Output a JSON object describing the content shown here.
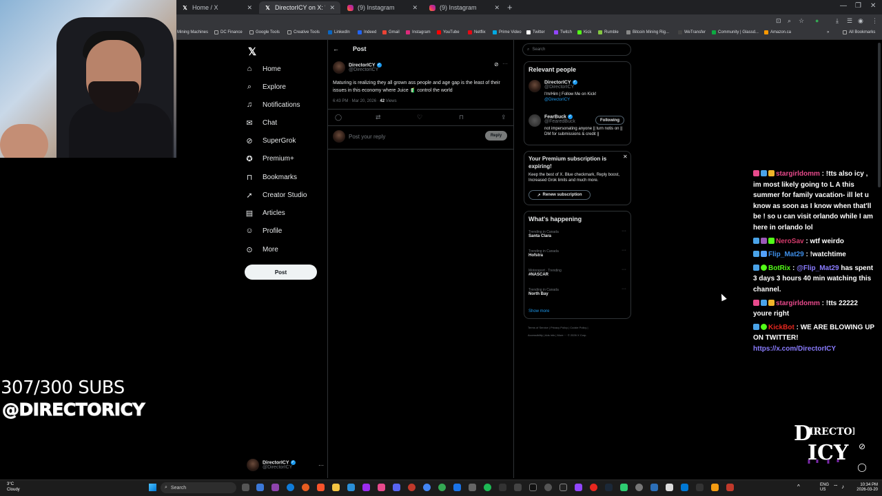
{
  "browser": {
    "tabs": [
      {
        "title": "Home / X",
        "icon": "x-icon"
      },
      {
        "title": "DirectorICY on X: \"@FearedBuc",
        "icon": "x-icon"
      },
      {
        "title": "(9) Instagram",
        "icon": "instagram-icon"
      },
      {
        "title": "(9) Instagram",
        "icon": "instagram-icon"
      }
    ],
    "bookmarks": [
      "Mining Machines",
      "DC Finance",
      "Google Tools",
      "Creative Tools",
      "LinkedIn",
      "Indeed",
      "Gmail",
      "Instagram",
      "YouTube",
      "Netflix",
      "Prime Video",
      "Twitter",
      "Twitch",
      "Kick",
      "Rumble",
      "Bitcoin Mining Rig...",
      "WeTransfer",
      "Community | Glassd...",
      "Amazon.ca",
      "All Bookmarks"
    ]
  },
  "nav": {
    "items": [
      {
        "label": "Home",
        "icon": "home-icon"
      },
      {
        "label": "Explore",
        "icon": "search-icon"
      },
      {
        "label": "Notifications",
        "icon": "bell-icon"
      },
      {
        "label": "Chat",
        "icon": "mail-icon"
      },
      {
        "label": "SuperGrok",
        "icon": "grok-icon"
      },
      {
        "label": "Premium+",
        "icon": "premium-icon"
      },
      {
        "label": "Bookmarks",
        "icon": "bookmark-icon"
      },
      {
        "label": "Creator Studio",
        "icon": "rocket-icon"
      },
      {
        "label": "Articles",
        "icon": "article-icon"
      },
      {
        "label": "Profile",
        "icon": "user-icon"
      },
      {
        "label": "More",
        "icon": "more-icon"
      }
    ],
    "post_button": "Post"
  },
  "account": {
    "name": "DirectorICY",
    "handle": "@DirectorICY"
  },
  "post": {
    "header": "Post",
    "author_name": "DirectorICY",
    "author_handle": "@DirectorICY",
    "text": "Maturing is realizing they all grown ass people and age gap is the least of their issues in this economy where Juice 🧃 control the world",
    "time": "6:43 PM · Mar 20, 2026 · ",
    "views_count": "42",
    "views_label": "Views",
    "reply_placeholder": "Post your reply",
    "reply_button": "Reply"
  },
  "sidebar": {
    "search_placeholder": "Search",
    "relevant_title": "Relevant people",
    "people": [
      {
        "name": "DirectorICY",
        "handle": "@DirectorICY",
        "bio": "I'm/Him | Follow Me on Kick!",
        "bio_link": "@DirectorICY"
      },
      {
        "name": "FearBuck",
        "handle": "@FearedBuck",
        "bio": "not impersonating anyone || turn notis on || DM for submissions & credit ||",
        "follow": "Following"
      }
    ],
    "premium": {
      "title": "Your Premium subscription is expiring!",
      "body": "Keep the best of X. Blue checkmark, Reply boost, Increased Grok limits and much more.",
      "button": "Renew subscription"
    },
    "happening": {
      "title": "What's happening",
      "trends": [
        {
          "category": "Trending in Canada",
          "name": "Santa Clara"
        },
        {
          "category": "Trending in Canada",
          "name": "Hofstra"
        },
        {
          "category": "Motorsport · Trending",
          "name": "#NASCAR"
        },
        {
          "category": "Trending in Canada",
          "name": "North Bay"
        }
      ],
      "show_more": "Show more"
    },
    "footer_line1": "Terms of Service  |  Privacy Policy  |  Cookie Policy  |",
    "footer_line2": "Accessibility  |  Ads info  |  More ···  © 2026 X Corp."
  },
  "overlay": {
    "subs": "307/300 SUBS",
    "handle": "@DIRECTORICY",
    "chat": [
      {
        "user": "stargirldomm",
        "user_color": "#e84a8c",
        "sep": " : ",
        "text": "!tts also icy , im most likely going to L A this summer for family vacation- ill let u know as soon as I know when that'll be ! so u can visit orlando while I am here in orlando lol"
      },
      {
        "user": "NeroSav",
        "user_color": "#d43b6b",
        "sep": " : ",
        "text": "wtf weirdo"
      },
      {
        "user": "Flip_Mat29",
        "user_color": "#3e8ee8",
        "sep": " : ",
        "text": "!watchtime"
      },
      {
        "user": "BotRix",
        "user_color": "#53fc18",
        "sep": " : ",
        "mention": "@Flip_Mat29",
        "text": " has spent 3 days 3 hours 40 min watching this channel."
      },
      {
        "user": "stargirldomm",
        "user_color": "#e84a8c",
        "sep": " : ",
        "text": "!tts 22222 youre right"
      },
      {
        "user": "KickBot",
        "user_color": "#e8271f",
        "sep": " : ",
        "text": "WE ARE BLOWING UP ON TWITTER! ",
        "link": "https://x.com/DirectorICY"
      }
    ],
    "logo_text": "DIRECTOR ICY"
  },
  "taskbar": {
    "temp": "3°C",
    "weather": "Cloudy",
    "search": "Search",
    "lang1": "ENG",
    "lang2": "US",
    "time": "10:34 PM",
    "date": "2026-03-20"
  }
}
